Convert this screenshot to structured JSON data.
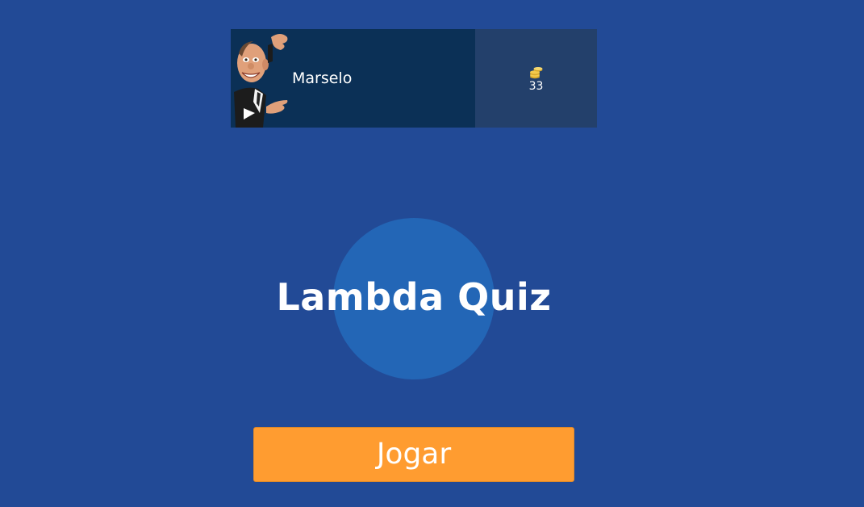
{
  "profile": {
    "avatar_icon": "cartoon-businessman-avatar",
    "username": "Marselo"
  },
  "coins": {
    "icon": "coin-stack-icon",
    "value": "33"
  },
  "main": {
    "title": "Lambda Quiz"
  },
  "actions": {
    "play_label": "Jogar"
  },
  "colors": {
    "background": "#224a96",
    "profile_bg": "#0b3056",
    "coins_bg": "#23406b",
    "circle": "#2366b6",
    "play_button": "#ff9c30",
    "coin_gold": "#f2c94c"
  }
}
